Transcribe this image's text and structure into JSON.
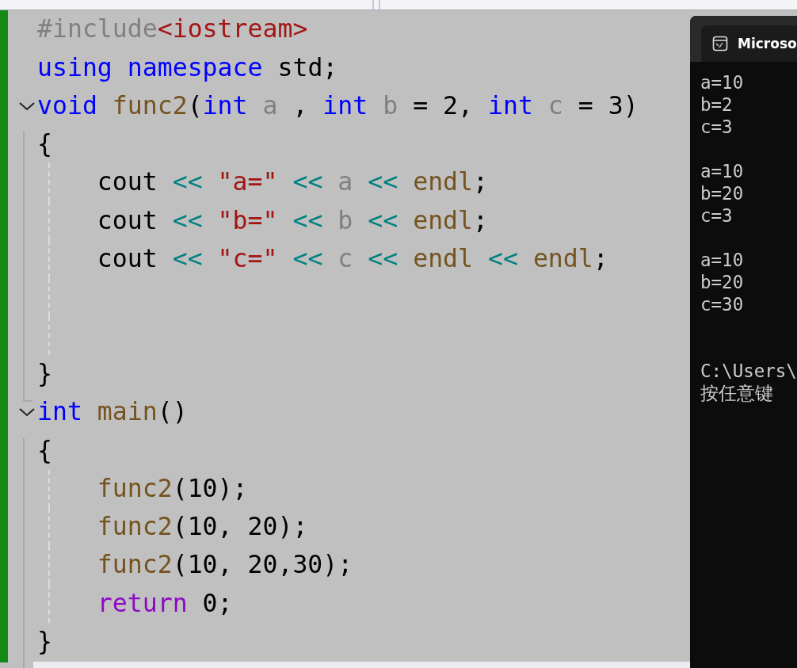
{
  "editor": {
    "lines": [
      {
        "tokens": [
          {
            "text": "#include",
            "kind": "preproc"
          },
          {
            "text": "<iostream>",
            "kind": "include"
          }
        ]
      },
      {
        "tokens": [
          {
            "text": "using ",
            "kind": "keyword"
          },
          {
            "text": "namespace ",
            "kind": "keyword"
          },
          {
            "text": "std;",
            "kind": "plain"
          }
        ]
      },
      {
        "fold": {
          "expanded": true
        },
        "tokens": [
          {
            "text": "void ",
            "kind": "keyword"
          },
          {
            "text": "func2",
            "kind": "function"
          },
          {
            "text": "(",
            "kind": "plain"
          },
          {
            "text": "int ",
            "kind": "keyword"
          },
          {
            "text": "a",
            "kind": "param"
          },
          {
            "text": " , ",
            "kind": "plain"
          },
          {
            "text": "int ",
            "kind": "keyword"
          },
          {
            "text": "b",
            "kind": "param"
          },
          {
            "text": " = 2, ",
            "kind": "plain"
          },
          {
            "text": "int ",
            "kind": "keyword"
          },
          {
            "text": "c",
            "kind": "param"
          },
          {
            "text": " = 3)",
            "kind": "plain"
          }
        ]
      },
      {
        "tokens": [
          {
            "text": "{",
            "kind": "plain"
          }
        ]
      },
      {
        "kind": "body",
        "tokens": [
          {
            "text": "    cout ",
            "kind": "plain"
          },
          {
            "text": "<< ",
            "kind": "operator"
          },
          {
            "text": "\"a=\" ",
            "kind": "string"
          },
          {
            "text": "<< ",
            "kind": "operator"
          },
          {
            "text": "a ",
            "kind": "param"
          },
          {
            "text": "<< ",
            "kind": "operator"
          },
          {
            "text": "endl",
            "kind": "function"
          },
          {
            "text": ";",
            "kind": "plain"
          }
        ]
      },
      {
        "kind": "body",
        "tokens": [
          {
            "text": "    cout ",
            "kind": "plain"
          },
          {
            "text": "<< ",
            "kind": "operator"
          },
          {
            "text": "\"b=\" ",
            "kind": "string"
          },
          {
            "text": "<< ",
            "kind": "operator"
          },
          {
            "text": "b ",
            "kind": "param"
          },
          {
            "text": "<< ",
            "kind": "operator"
          },
          {
            "text": "endl",
            "kind": "function"
          },
          {
            "text": ";",
            "kind": "plain"
          }
        ]
      },
      {
        "kind": "body",
        "tokens": [
          {
            "text": "    cout ",
            "kind": "plain"
          },
          {
            "text": "<< ",
            "kind": "operator"
          },
          {
            "text": "\"c=\" ",
            "kind": "string"
          },
          {
            "text": "<< ",
            "kind": "operator"
          },
          {
            "text": "c ",
            "kind": "param"
          },
          {
            "text": "<< ",
            "kind": "operator"
          },
          {
            "text": "endl ",
            "kind": "function"
          },
          {
            "text": "<< ",
            "kind": "operator"
          },
          {
            "text": "endl",
            "kind": "function"
          },
          {
            "text": ";",
            "kind": "plain"
          }
        ]
      },
      {
        "kind": "body"
      },
      {
        "kind": "body"
      },
      {
        "tokens": [
          {
            "text": "}",
            "kind": "plain"
          }
        ]
      },
      {
        "fold": {
          "expanded": true
        },
        "tokens": [
          {
            "text": "int ",
            "kind": "keyword"
          },
          {
            "text": "main",
            "kind": "function"
          },
          {
            "text": "()",
            "kind": "plain"
          }
        ]
      },
      {
        "tokens": [
          {
            "text": "{",
            "kind": "plain"
          }
        ]
      },
      {
        "kind": "body",
        "tokens": [
          {
            "text": "    func2",
            "kind": "function"
          },
          {
            "text": "(10);",
            "kind": "plain"
          }
        ]
      },
      {
        "kind": "body",
        "tokens": [
          {
            "text": "    func2",
            "kind": "function"
          },
          {
            "text": "(10, 20);",
            "kind": "plain"
          }
        ]
      },
      {
        "kind": "body",
        "tokens": [
          {
            "text": "    func2",
            "kind": "function"
          },
          {
            "text": "(10, 20,30);",
            "kind": "plain"
          }
        ]
      },
      {
        "kind": "body",
        "tokens": [
          {
            "text": "    return",
            "kind": "control"
          },
          {
            "text": " 0;",
            "kind": "plain"
          }
        ]
      },
      {
        "tokens": [
          {
            "text": "}",
            "kind": "plain"
          }
        ]
      }
    ]
  },
  "console": {
    "title": "Microso",
    "lines": [
      {
        "kind": "text",
        "text": "a=10"
      },
      {
        "kind": "text",
        "text": "b=2"
      },
      {
        "kind": "text",
        "text": "c=3"
      },
      {
        "kind": "blank"
      },
      {
        "kind": "text",
        "text": "a=10"
      },
      {
        "kind": "text",
        "text": "b=20"
      },
      {
        "kind": "text",
        "text": "c=3"
      },
      {
        "kind": "blank"
      },
      {
        "kind": "text",
        "text": "a=10"
      },
      {
        "kind": "text",
        "text": "b=20"
      },
      {
        "kind": "text",
        "text": "c=30"
      },
      {
        "kind": "blank"
      },
      {
        "kind": "blank"
      },
      {
        "kind": "text",
        "text": "C:\\Users\\"
      },
      {
        "kind": "text",
        "text": "按任意键"
      }
    ]
  }
}
